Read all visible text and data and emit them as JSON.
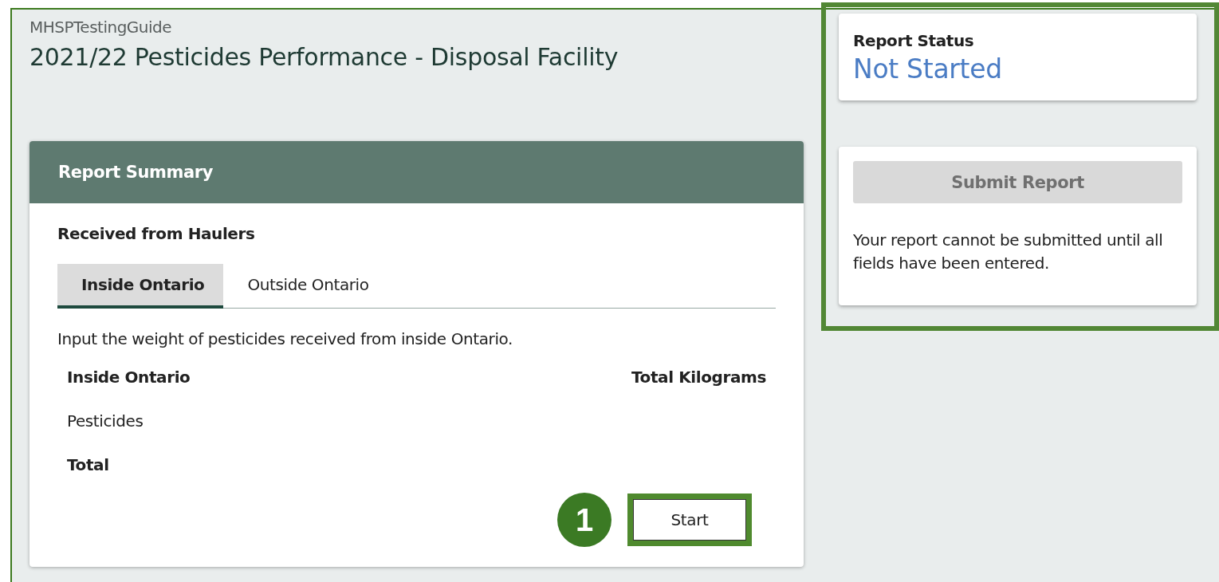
{
  "breadcrumb": "MHSPTestingGuide",
  "title": "2021/22 Pesticides Performance - Disposal Facility",
  "summary": {
    "heading": "Report Summary",
    "section": "Received from Haulers",
    "tabs": [
      {
        "label": "Inside Ontario",
        "selected": true
      },
      {
        "label": "Outside Ontario",
        "selected": false
      }
    ],
    "instruction": "Input the weight of pesticides received from inside Ontario.",
    "columns": [
      "Inside Ontario",
      "Total Kilograms"
    ],
    "rows": [
      {
        "label": "Pesticides",
        "kind": "item"
      },
      {
        "label": "Total",
        "kind": "total"
      }
    ],
    "step_badge": "1",
    "start_button": {
      "label": "Start",
      "highlighted": true
    }
  },
  "side_panel": {
    "highlighted": true,
    "status": {
      "label": "Report Status",
      "value": "Not Started"
    },
    "submit_button": {
      "label": "Submit Report",
      "disabled": true
    },
    "note": "Your report cannot be submitted until all fields have been entered."
  }
}
